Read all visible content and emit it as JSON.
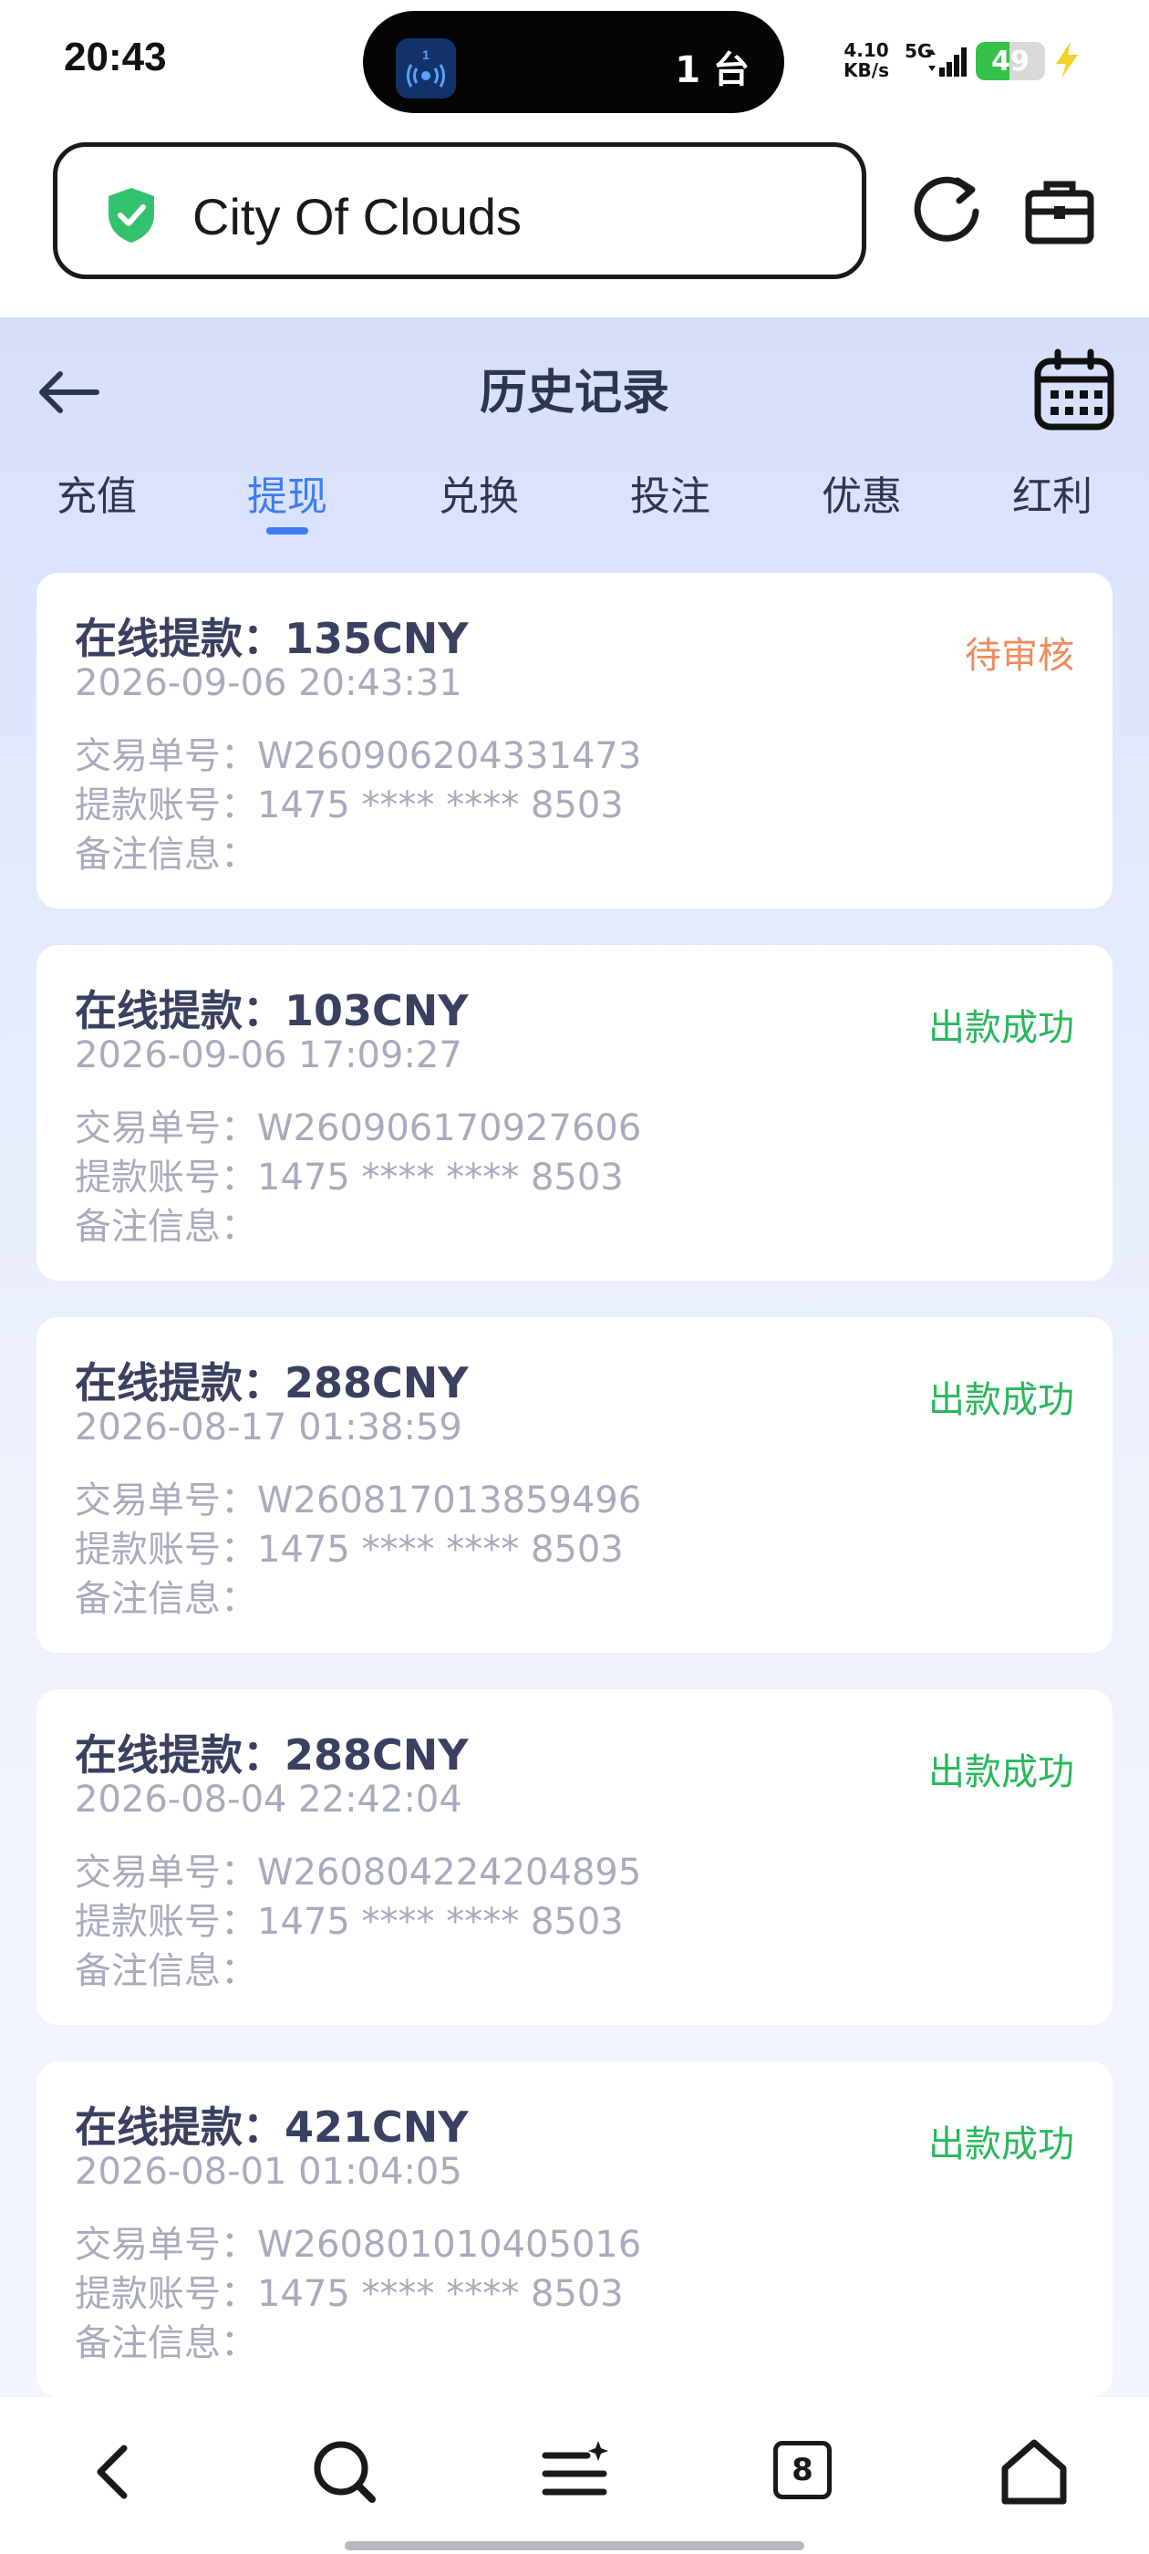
{
  "status_bar": {
    "time": "20:43",
    "island_badge": "1",
    "island_count": "1 台",
    "net_speed_value": "4.10",
    "net_speed_unit": "KB/s",
    "network_type": "5G",
    "battery_level": "49",
    "battery_color": "#35c24a"
  },
  "browser": {
    "url_text": "City Of Clouds",
    "shield_color": "#35c26e"
  },
  "page": {
    "title": "历史记录",
    "accent_color": "#3d7cf3",
    "tabs": [
      {
        "label": "充值",
        "active": false
      },
      {
        "label": "提现",
        "active": true
      },
      {
        "label": "兑换",
        "active": false
      },
      {
        "label": "投注",
        "active": false
      },
      {
        "label": "优惠",
        "active": false
      },
      {
        "label": "红利",
        "active": false
      }
    ]
  },
  "records": [
    {
      "title": "在线提款：135CNY",
      "time": "2026-09-06 20:43:31",
      "status": "待审核",
      "order": "交易单号：W260906204331473",
      "account": "提款账号：1475 **** **** 8503",
      "remark": "备注信息："
    },
    {
      "title": "在线提款：103CNY",
      "time": "2026-09-06 17:09:27",
      "status": "出款成功",
      "order": "交易单号：W260906170927606",
      "account": "提款账号：1475 **** **** 8503",
      "remark": "备注信息："
    },
    {
      "title": "在线提款：288CNY",
      "time": "2026-08-17 01:38:59",
      "status": "出款成功",
      "order": "交易单号：W260817013859496",
      "account": "提款账号：1475 **** **** 8503",
      "remark": "备注信息："
    },
    {
      "title": "在线提款：288CNY",
      "time": "2026-08-04 22:42:04",
      "status": "出款成功",
      "order": "交易单号：W260804224204895",
      "account": "提款账号：1475 **** **** 8503",
      "remark": "备注信息："
    },
    {
      "title": "在线提款：421CNY",
      "time": "2026-08-01 01:04:05",
      "status": "出款成功",
      "order": "交易单号：W260801010405016",
      "account": "提款账号：1475 **** **** 8503",
      "remark": "备注信息："
    }
  ],
  "bottom_nav": {
    "tab_count": "8",
    "icons": [
      "back-icon",
      "search-icon",
      "menu-icon",
      "tabs-icon",
      "home-icon"
    ]
  }
}
